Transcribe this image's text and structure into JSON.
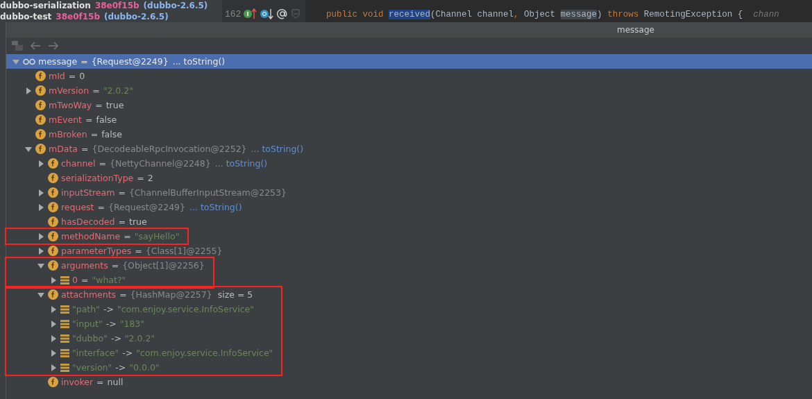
{
  "vcs_panel": {
    "lines": [
      {
        "module": "dubbo-serialization",
        "revision": "38e0f15b",
        "branch": "(dubbo-2.6.5)"
      },
      {
        "module": "dubbo-test",
        "revision": "38e0f15b",
        "branch": "(dubbo-2.6.5)"
      }
    ]
  },
  "editor": {
    "line_number": "162",
    "code": [
      {
        "kind": "keyword",
        "text": "public void "
      },
      {
        "kind": "highlight",
        "text": "received"
      },
      {
        "kind": "plain",
        "text": "(Channel channel"
      },
      {
        "kind": "punct",
        "text": ", "
      },
      {
        "kind": "plain",
        "text": "Object "
      },
      {
        "kind": "usage",
        "text": "message"
      },
      {
        "kind": "plain",
        "text": ") "
      },
      {
        "kind": "keyword",
        "text": "throws "
      },
      {
        "kind": "plain",
        "text": "RemotingException {  "
      },
      {
        "kind": "hint",
        "text": "chann"
      }
    ]
  },
  "popup": {
    "title": "message",
    "tree": [
      {
        "kind": "watch",
        "name": "message",
        "operator": "=",
        "value": "{Request@2249}",
        "action": "... toString()",
        "expanded": true,
        "selected": true,
        "highlighted": false,
        "children": [
          {
            "kind": "field-plain",
            "name": "mId",
            "operator": "=",
            "value": "0",
            "selected": false,
            "highlighted": false
          },
          {
            "kind": "field-string",
            "name": "mVersion",
            "operator": "=",
            "value": "\"2.0.2\"",
            "expanded": false,
            "selected": false,
            "highlighted": false
          },
          {
            "kind": "field-plain",
            "name": "mTwoWay",
            "operator": "=",
            "value": "true",
            "selected": false,
            "highlighted": false
          },
          {
            "kind": "field-plain",
            "name": "mEvent",
            "operator": "=",
            "value": "false",
            "selected": false,
            "highlighted": false
          },
          {
            "kind": "field-plain",
            "name": "mBroken",
            "operator": "=",
            "value": "false",
            "selected": false,
            "highlighted": false
          },
          {
            "kind": "field-ref",
            "name": "mData",
            "operator": "=",
            "value": "{DecodeableRpcInvocation@2252}",
            "action": "... toString()",
            "expanded": true,
            "selected": false,
            "highlighted": false,
            "children": [
              {
                "kind": "field-ref",
                "name": "channel",
                "operator": "=",
                "value": "{NettyChannel@2248}",
                "action": "... toString()",
                "expanded": false,
                "selected": false,
                "highlighted": false
              },
              {
                "kind": "field-plain",
                "name": "serializationType",
                "operator": "=",
                "value": "2",
                "selected": false,
                "highlighted": false
              },
              {
                "kind": "field-ref",
                "name": "inputStream",
                "operator": "=",
                "value": "{ChannelBufferInputStream@2253}",
                "expanded": false,
                "selected": false,
                "highlighted": false
              },
              {
                "kind": "field-ref",
                "name": "request",
                "operator": "=",
                "value": "{Request@2249}",
                "action": "... toString()",
                "expanded": false,
                "selected": false,
                "highlighted": false
              },
              {
                "kind": "field-plain",
                "name": "hasDecoded",
                "operator": "=",
                "value": "true",
                "selected": false,
                "highlighted": false
              },
              {
                "kind": "field-string",
                "name": "methodName",
                "operator": "=",
                "value": "\"sayHello\"",
                "expanded": false,
                "selected": false,
                "highlighted": true
              },
              {
                "kind": "field-ref",
                "name": "parameterTypes",
                "operator": "=",
                "value": "{Class[1]@2255}",
                "expanded": false,
                "selected": false,
                "highlighted": false
              },
              {
                "kind": "field-ref",
                "name": "arguments",
                "operator": "=",
                "value": "{Object[1]@2256}",
                "expanded": true,
                "selected": false,
                "highlighted": true,
                "children": [
                  {
                    "kind": "element",
                    "name": "0",
                    "operator": "=",
                    "value": "\"what?\"",
                    "expanded": false,
                    "selected": false,
                    "highlighted": false
                  }
                ]
              },
              {
                "kind": "field-ref",
                "name": "attachments",
                "operator": "=",
                "value": "{HashMap@2257}",
                "extra": "size = 5",
                "expanded": true,
                "selected": false,
                "highlighted": true,
                "children": [
                  {
                    "kind": "entry",
                    "name": "\"path\"",
                    "operator": "->",
                    "value": "\"com.enjoy.service.InfoService\"",
                    "expanded": false,
                    "selected": false,
                    "highlighted": false
                  },
                  {
                    "kind": "entry",
                    "name": "\"input\"",
                    "operator": "->",
                    "value": "\"183\"",
                    "expanded": false,
                    "selected": false,
                    "highlighted": false
                  },
                  {
                    "kind": "entry",
                    "name": "\"dubbo\"",
                    "operator": "->",
                    "value": "\"2.0.2\"",
                    "expanded": false,
                    "selected": false,
                    "highlighted": false
                  },
                  {
                    "kind": "entry",
                    "name": "\"interface\"",
                    "operator": "->",
                    "value": "\"com.enjoy.service.InfoService\"",
                    "expanded": false,
                    "selected": false,
                    "highlighted": false
                  },
                  {
                    "kind": "entry",
                    "name": "\"version\"",
                    "operator": "->",
                    "value": "\"0.0.0\"",
                    "expanded": false,
                    "selected": false,
                    "highlighted": false
                  }
                ]
              },
              {
                "kind": "field-plain",
                "name": "invoker",
                "operator": "=",
                "value": "null",
                "selected": false,
                "highlighted": false
              }
            ]
          }
        ]
      }
    ]
  }
}
